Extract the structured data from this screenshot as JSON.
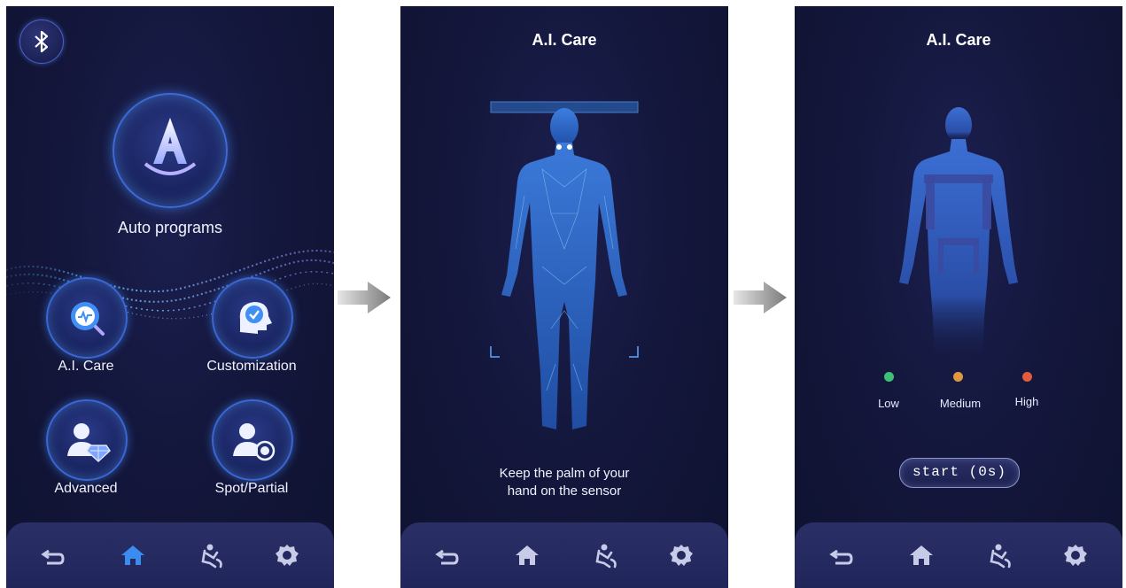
{
  "screen1": {
    "auto_label": "Auto programs",
    "menu": [
      {
        "label": "A.I. Care"
      },
      {
        "label": "Customization"
      },
      {
        "label": "Advanced"
      },
      {
        "label": "Spot/Partial"
      }
    ]
  },
  "screen2": {
    "title": "A.I. Care",
    "instruction_line1": "Keep the palm of your",
    "instruction_line2": "hand on the sensor"
  },
  "screen3": {
    "title": "A.I. Care",
    "legend": [
      {
        "label": "Low",
        "color": "#3fbf74"
      },
      {
        "label": "Medium",
        "color": "#e0973f"
      },
      {
        "label": "High",
        "color": "#e45a3d"
      }
    ],
    "start_label": "start (0s)"
  },
  "nav": {
    "icons": [
      "back-icon",
      "home-icon",
      "massage-chair-icon",
      "settings-icon"
    ],
    "active_color": "#3b8cf0",
    "inactive_color": "#c7cbe8"
  }
}
